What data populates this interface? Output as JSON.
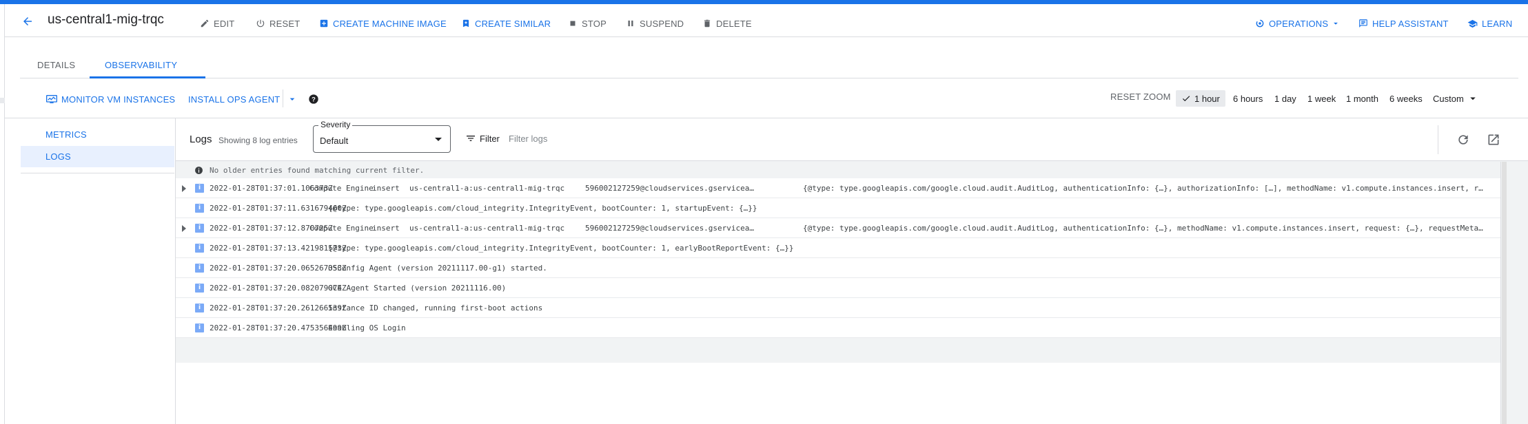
{
  "header": {
    "title": "us-central1-mig-trqc",
    "actions": {
      "edit": "EDIT",
      "reset": "RESET",
      "create_machine_image": "CREATE MACHINE IMAGE",
      "create_similar": "CREATE SIMILAR",
      "stop": "STOP",
      "suspend": "SUSPEND",
      "delete": "DELETE",
      "operations": "OPERATIONS",
      "help_assistant": "HELP ASSISTANT",
      "learn": "LEARN"
    }
  },
  "tabs": [
    {
      "label": "DETAILS",
      "active": false
    },
    {
      "label": "OBSERVABILITY",
      "active": true
    }
  ],
  "toolbar": {
    "monitor_vm_instances": "MONITOR VM INSTANCES",
    "install_ops_agent": "INSTALL OPS AGENT",
    "reset_zoom": "RESET ZOOM",
    "time_ranges": [
      "1 hour",
      "6 hours",
      "1 day",
      "1 week",
      "1 month",
      "6 weeks",
      "Custom"
    ],
    "selected_time_range": "1 hour"
  },
  "sidebar": {
    "items": [
      {
        "label": "METRICS",
        "active": false
      },
      {
        "label": "LOGS",
        "active": true
      }
    ]
  },
  "logs": {
    "title": "Logs",
    "count_text": "Showing 8 log entries",
    "severity": {
      "label": "Severity",
      "value": "Default"
    },
    "filter": {
      "label": "Filter",
      "placeholder": "Filter logs"
    },
    "info_message": "No older entries found matching current filter.",
    "entries": [
      {
        "expandable": true,
        "severity": "i",
        "timestamp": "2022-01-28T01:37:01.106373Z",
        "service": "Compute Engine",
        "method": "insert",
        "resource": "us-central1-a:us-central1-mig-trqc",
        "principal": "596002127259@cloudservices.gserviceac…",
        "payload": "{@type: type.googleapis.com/google.cloud.audit.AuditLog, authenticationInfo: {…}, authorizationInfo: […], methodName: v1.compute.instances.insert, r…"
      },
      {
        "expandable": false,
        "severity": "i",
        "timestamp": "2022-01-28T01:37:11.631679460Z",
        "summary": "{@type: type.googleapis.com/cloud_integrity.IntegrityEvent, bootCounter: 1, startupEvent: {…}}"
      },
      {
        "expandable": true,
        "severity": "i",
        "timestamp": "2022-01-28T01:37:12.870725Z",
        "service": "Compute Engine",
        "method": "insert",
        "resource": "us-central1-a:us-central1-mig-trqc",
        "principal": "596002127259@cloudservices.gserviceac…",
        "payload": "{@type: type.googleapis.com/google.cloud.audit.AuditLog, authenticationInfo: {…}, methodName: v1.compute.instances.insert, request: {…}, requestMeta…"
      },
      {
        "expandable": false,
        "severity": "i",
        "timestamp": "2022-01-28T01:37:13.421981573Z",
        "summary": "{@type: type.googleapis.com/cloud_integrity.IntegrityEvent, bootCounter: 1, earlyBootReportEvent: {…}}"
      },
      {
        "expandable": false,
        "severity": "i",
        "timestamp": "2022-01-28T01:37:20.065267353Z",
        "summary": "OSConfig Agent (version 20211117.00-g1) started."
      },
      {
        "expandable": false,
        "severity": "i",
        "timestamp": "2022-01-28T01:37:20.082079074Z",
        "summary": "GCE Agent Started (version 20211116.00)"
      },
      {
        "expandable": false,
        "severity": "i",
        "timestamp": "2022-01-28T01:37:20.261266539Z",
        "summary": "Instance ID changed, running first-boot actions"
      },
      {
        "expandable": false,
        "severity": "i",
        "timestamp": "2022-01-28T01:37:20.475356499Z",
        "summary": "Enabling OS Login"
      }
    ]
  },
  "colors": {
    "accent": "#1a73e8",
    "severity_info": "#7baaf7",
    "text_secondary": "#5f6368"
  }
}
